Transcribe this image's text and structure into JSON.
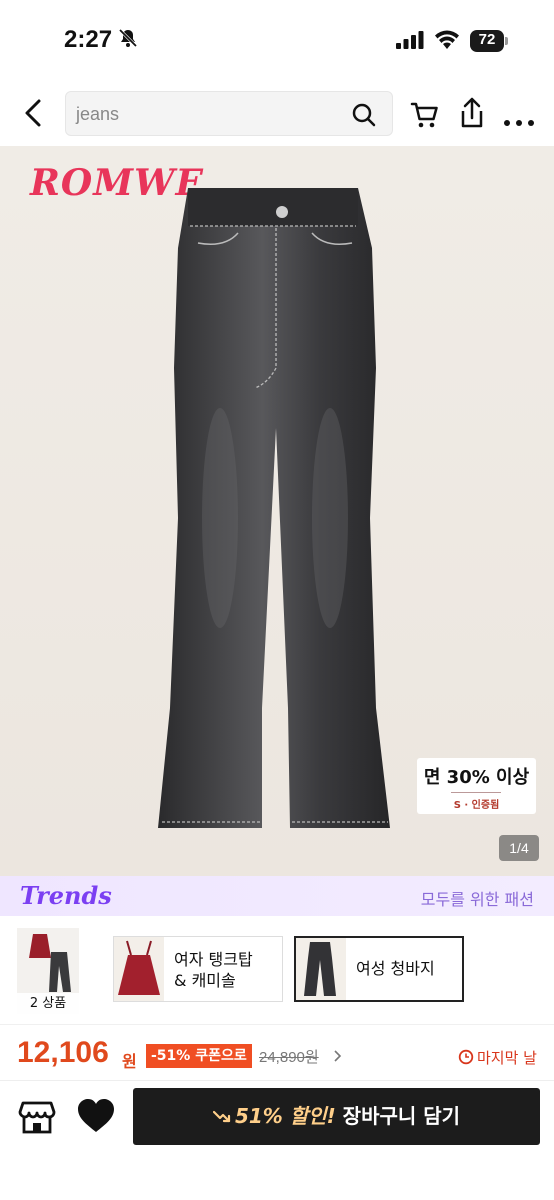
{
  "status_bar": {
    "time": "2:27",
    "battery": "72"
  },
  "nav": {
    "search_value": "jeans"
  },
  "product": {
    "brand": "ROMWE",
    "cotton_badge": "면 30% 이상",
    "cert": "S · 인증됨",
    "image_counter": "1/4"
  },
  "trends": {
    "logo": "Trends",
    "caption": "모두를 위한 패션"
  },
  "bundle": {
    "count_label": "2 상품",
    "items": [
      {
        "label_line1": "여자 탱크탑",
        "label_line2": "& 캐미솔"
      },
      {
        "label": "여성 청바지"
      }
    ]
  },
  "price": {
    "amount": "12,106",
    "currency": "원",
    "coupon": "-51% 쿠폰으로",
    "original": "24,890원",
    "last_day": "마지막 날"
  },
  "cta": {
    "percent": "51%",
    "discount": "할인!",
    "label": "장바구니 담기"
  },
  "colors": {
    "accent": "#e0491d",
    "brand": "#e8355a",
    "trends": "#7b3ff2",
    "cta_bg": "#1c1c1c"
  }
}
